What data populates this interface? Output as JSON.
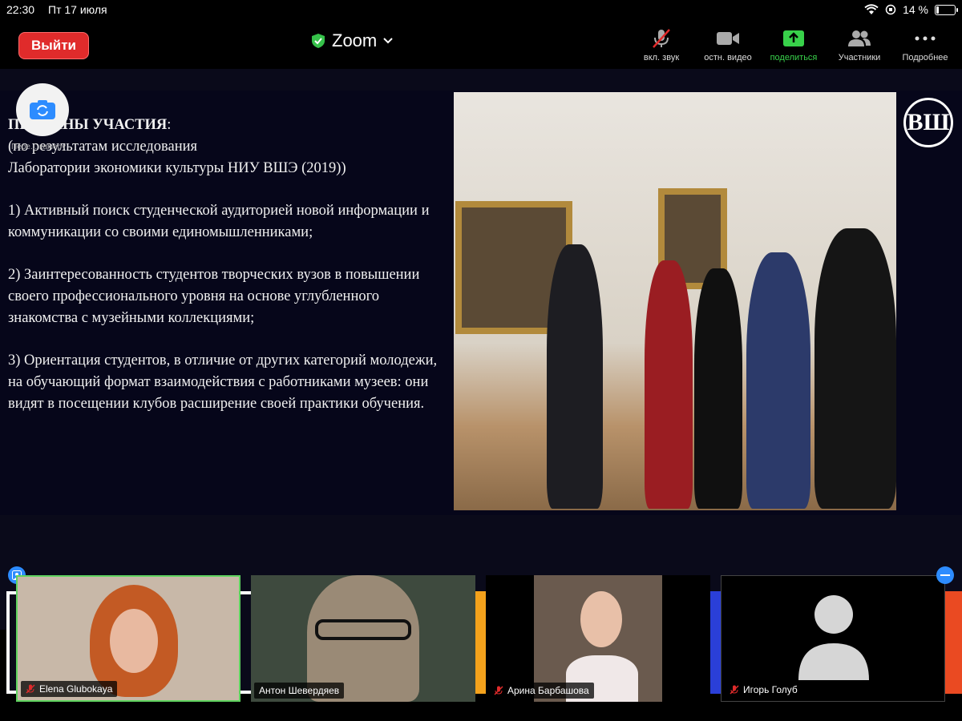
{
  "status_bar": {
    "time": "22:30",
    "date": "Пт 17 июля",
    "battery": "14 %",
    "battery_level": 0.14
  },
  "toolbar": {
    "leave_label": "Выйти",
    "app_title": "Zoom",
    "items": [
      {
        "label": "вкл. звук",
        "icon": "mic-muted-icon"
      },
      {
        "label": "остн. видео",
        "icon": "video-camera-icon"
      },
      {
        "label": "поделиться",
        "icon": "share-screen-icon"
      },
      {
        "label": "Участники",
        "icon": "participants-icon"
      },
      {
        "label": "Подробнее",
        "icon": "more-icon"
      }
    ]
  },
  "camera_switch_label": "Пере... камеру",
  "slide": {
    "heading": "ПРИЧИНЫ УЧАСТИЯ",
    "heading_suffix": ":",
    "intro_1": "(по результатам исследования",
    "intro_2": "Лаборатории экономики культуры НИУ ВШЭ (2019))",
    "point_1": "1) Активный поиск студенческой аудиторией новой информации и коммуникации со своими единомышленниками;",
    "point_2": "2) Заинтересованность студентов творческих вузов в повышении своего профессионального уровня на основе углубленного знакомства с музейными коллекциями;",
    "point_3": "3) Ориентация студентов, в отличие от других категорий молодежи, на обучающий формат взаимодействия с работниками музеев: они видят в посещении клубов расширение своей практики обучения.",
    "logo": "ВШ"
  },
  "participants": [
    {
      "name": "Elena Glubokaya",
      "muted": true,
      "active": true
    },
    {
      "name": "Антон Шевердяев",
      "muted": false,
      "active": false
    },
    {
      "name": "Арина Барбашова",
      "muted": true,
      "active": false
    },
    {
      "name": "Игорь Голуб",
      "muted": true,
      "active": false
    }
  ],
  "colors": {
    "leave": "#e02b2b",
    "share_green": "#38d14a",
    "active_speaker": "#5fd35f",
    "accent_blue": "#2d8cff"
  }
}
